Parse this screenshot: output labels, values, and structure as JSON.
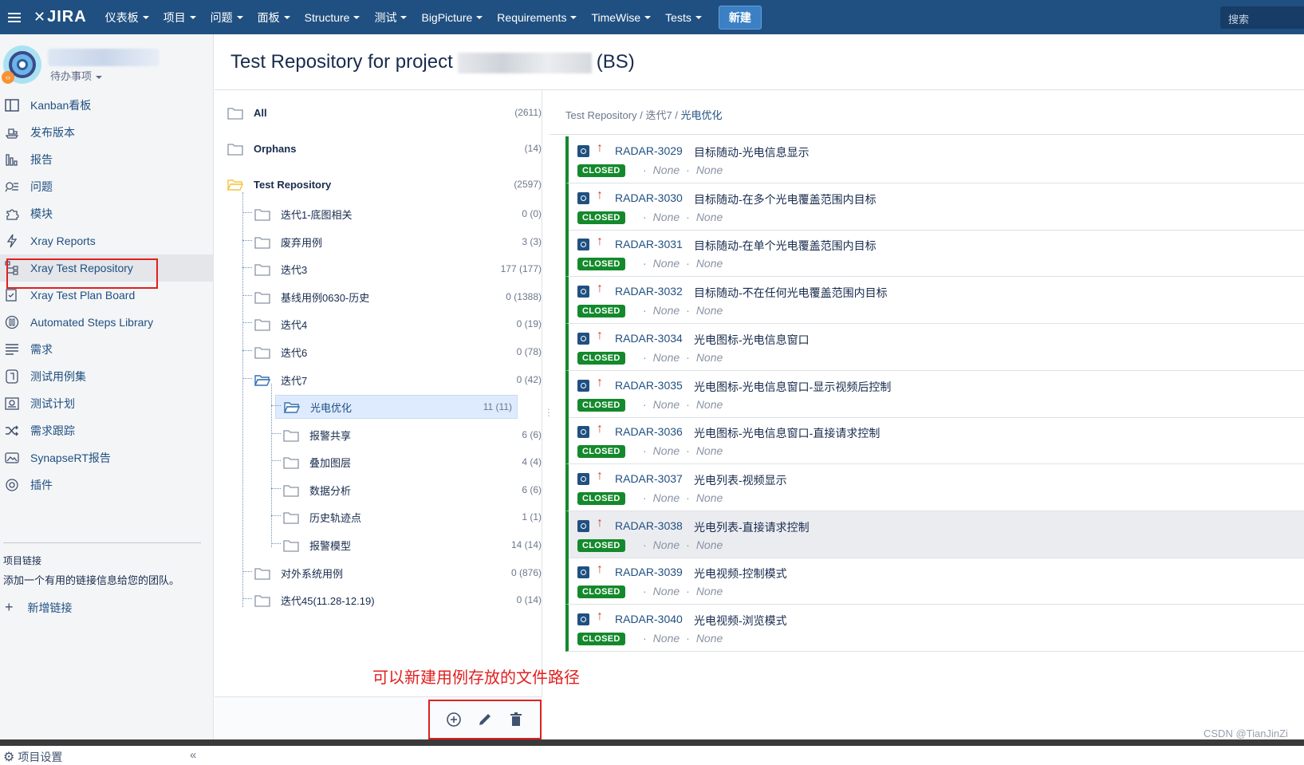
{
  "nav": {
    "logo": "JIRA",
    "items": [
      "仪表板",
      "项目",
      "问题",
      "面板",
      "Structure",
      "测试",
      "BigPicture",
      "Requirements",
      "TimeWise",
      "Tests"
    ],
    "create_label": "新建",
    "search_placeholder": "搜索"
  },
  "sidebar": {
    "project_sub": "待办事项",
    "items": [
      {
        "label": "Kanban看板",
        "icon": "board-icon"
      },
      {
        "label": "发布版本",
        "icon": "ship-icon"
      },
      {
        "label": "报告",
        "icon": "chart-icon"
      },
      {
        "label": "问题",
        "icon": "issues-icon"
      },
      {
        "label": "模块",
        "icon": "puzzle-icon"
      },
      {
        "label": "Xray Reports",
        "icon": "lightning-icon"
      },
      {
        "label": "Xray Test Repository",
        "icon": "tree-icon"
      },
      {
        "label": "Xray Test Plan Board",
        "icon": "checklist-icon"
      },
      {
        "label": "Automated Steps Library",
        "icon": "library-icon"
      },
      {
        "label": "需求",
        "icon": "lines-icon"
      },
      {
        "label": "测试用例集",
        "icon": "testset-icon"
      },
      {
        "label": "测试计划",
        "icon": "testplan-icon"
      },
      {
        "label": "需求跟踪",
        "icon": "shuffle-icon"
      },
      {
        "label": "SynapseRT报告",
        "icon": "picture-icon"
      },
      {
        "label": "插件",
        "icon": "plugin-icon"
      }
    ],
    "links_title": "项目链接",
    "links_desc": "添加一个有用的链接信息给您的团队。",
    "add_link": "新增链接",
    "settings": "项目设置",
    "collapse": "«"
  },
  "header": {
    "title_prefix": "Test Repository for project",
    "title_suffix": "(BS)"
  },
  "tree": {
    "rows": [
      {
        "name": "All",
        "count": "(2611)"
      },
      {
        "name": "Orphans",
        "count": "(14)"
      },
      {
        "name": "Test Repository",
        "count": "(2597)"
      },
      {
        "name": "迭代1-底图相关",
        "count": "0 (0)"
      },
      {
        "name": "废弃用例",
        "count": "3 (3)"
      },
      {
        "name": "迭代3",
        "count": "177 (177)"
      },
      {
        "name": "基线用例0630-历史",
        "count": "0 (1388)"
      },
      {
        "name": "迭代4",
        "count": "0 (19)"
      },
      {
        "name": "迭代6",
        "count": "0 (78)"
      },
      {
        "name": "迭代7",
        "count": "0 (42)"
      },
      {
        "name": "光电优化",
        "count": "11 (11)"
      },
      {
        "name": "报警共享",
        "count": "6 (6)"
      },
      {
        "name": "叠加图层",
        "count": "4 (4)"
      },
      {
        "name": "数据分析",
        "count": "6 (6)"
      },
      {
        "name": "历史轨迹点",
        "count": "1 (1)"
      },
      {
        "name": "报警模型",
        "count": "14 (14)"
      },
      {
        "name": "对外系统用例",
        "count": "0 (876)"
      },
      {
        "name": "迭代45(11.28-12.19)",
        "count": "0 (14)"
      }
    ],
    "annotation": "可以新建用例存放的文件路径"
  },
  "breadcrumb": {
    "root": "Test Repository",
    "sep": " / ",
    "mid": "迭代7",
    "current": "光电优化"
  },
  "tests": [
    {
      "key": "RADAR-3029",
      "summary": "目标随动-光电信息显示",
      "status": "CLOSED",
      "meta1": "None",
      "meta2": "None"
    },
    {
      "key": "RADAR-3030",
      "summary": "目标随动-在多个光电覆盖范围内目标",
      "status": "CLOSED",
      "meta1": "None",
      "meta2": "None"
    },
    {
      "key": "RADAR-3031",
      "summary": "目标随动-在单个光电覆盖范围内目标",
      "status": "CLOSED",
      "meta1": "None",
      "meta2": "None"
    },
    {
      "key": "RADAR-3032",
      "summary": "目标随动-不在任何光电覆盖范围内目标",
      "status": "CLOSED",
      "meta1": "None",
      "meta2": "None"
    },
    {
      "key": "RADAR-3034",
      "summary": "光电图标-光电信息窗口",
      "status": "CLOSED",
      "meta1": "None",
      "meta2": "None"
    },
    {
      "key": "RADAR-3035",
      "summary": "光电图标-光电信息窗口-显示视频后控制",
      "status": "CLOSED",
      "meta1": "None",
      "meta2": "None"
    },
    {
      "key": "RADAR-3036",
      "summary": "光电图标-光电信息窗口-直接请求控制",
      "status": "CLOSED",
      "meta1": "None",
      "meta2": "None"
    },
    {
      "key": "RADAR-3037",
      "summary": "光电列表-视频显示",
      "status": "CLOSED",
      "meta1": "None",
      "meta2": "None"
    },
    {
      "key": "RADAR-3038",
      "summary": "光电列表-直接请求控制",
      "status": "CLOSED",
      "meta1": "None",
      "meta2": "None"
    },
    {
      "key": "RADAR-3039",
      "summary": "光电视频-控制模式",
      "status": "CLOSED",
      "meta1": "None",
      "meta2": "None"
    },
    {
      "key": "RADAR-3040",
      "summary": "光电视频-浏览模式",
      "status": "CLOSED",
      "meta1": "None",
      "meta2": "None"
    }
  ],
  "watermark": "CSDN @TianJinZi",
  "colors": {
    "nav": "#205081",
    "status_closed": "#14892c",
    "annotation": "#e02020",
    "link": "#205081"
  }
}
